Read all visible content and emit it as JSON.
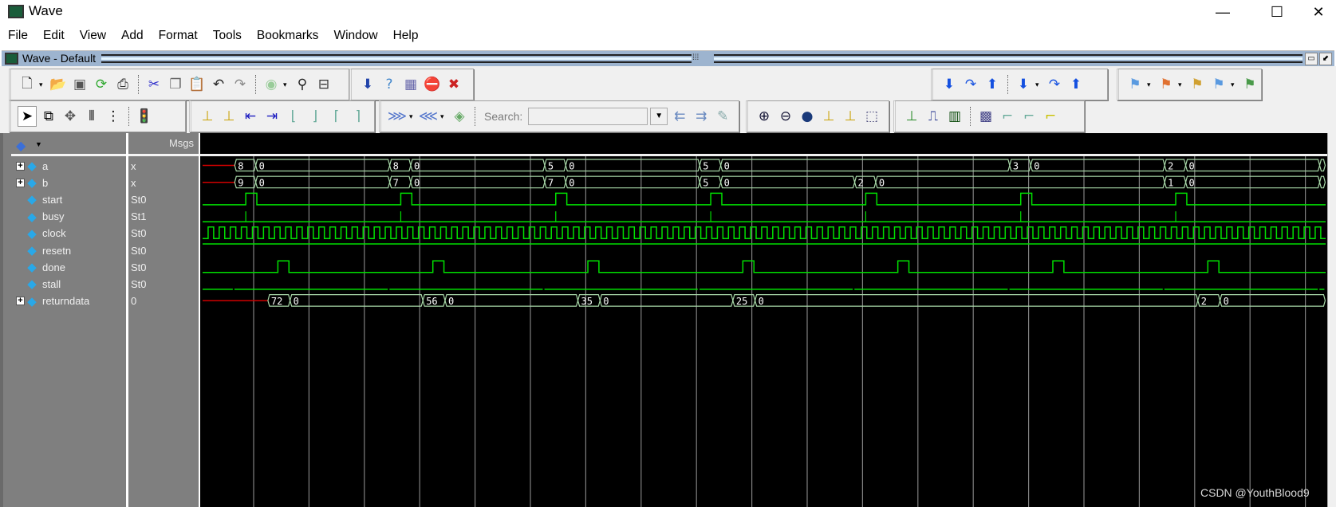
{
  "window": {
    "title": "Wave",
    "minimize": "—",
    "maximize": "☐",
    "close": "✕"
  },
  "menu": [
    "File",
    "Edit",
    "View",
    "Add",
    "Format",
    "Tools",
    "Bookmarks",
    "Window",
    "Help"
  ],
  "subwindow": {
    "title": "Wave - Default",
    "grip": "⁞⁞⁞",
    "btn1": "▭",
    "btn2": "⬋"
  },
  "toolbars": {
    "row1": [
      [
        "new-file-icon",
        "dropdown",
        "open-folder-icon",
        "save-icon",
        "reload-icon",
        "print-icon",
        "sep",
        "cut-icon",
        "copy-icon",
        "paste-icon",
        "undo-icon",
        "redo-icon",
        "sep",
        "run-icon",
        "dropdown",
        "find-icon",
        "collapse-all-icon"
      ],
      [
        "load-dataflow-icon",
        "query-icon",
        "memory-icon",
        "break-icon",
        "delete-icon"
      ],
      [
        "step-into-icon",
        "step-over-icon",
        "step-out-icon",
        "sep",
        "step-into-wave-icon",
        "dropdown",
        "step-over-wave-icon",
        "step-out-wave-icon"
      ],
      [
        "bookmark-add-icon",
        "dropdown",
        "bookmark-remove-icon",
        "dropdown",
        "bookmark-edit-icon",
        "bookmark-save-icon",
        "dropdown",
        "bookmark-goto-icon"
      ]
    ],
    "row2": [
      [
        "select-pointer-icon",
        "zoom-mode-icon",
        "pan-mode-icon",
        "cursor-mode-icon",
        "edit-mode-icon",
        "sep",
        "stop-light-icon"
      ],
      [
        "add-cursor-icon",
        "delete-cursor-icon",
        "prev-transition-icon",
        "next-transition-icon",
        "prev-falling-edge-icon",
        "next-falling-edge-icon",
        "prev-rising-edge-icon",
        "next-rising-edge-icon"
      ],
      [
        "expand-time-icon",
        "dropdown",
        "collapse-time-icon",
        "dropdown",
        "show-driver-icon",
        "sep",
        "search-label",
        "search-input",
        "search-dropdown",
        "search-prev-icon",
        "search-next-icon",
        "search-options-icon"
      ],
      [
        "zoom-in-icon",
        "zoom-out-icon",
        "zoom-full-icon",
        "zoom-cursor-icon",
        "zoom-between-cursors-icon",
        "zoom-region-icon"
      ],
      [
        "wave-edge-style-icon",
        "wave-pulse-style-icon",
        "wave-multi-style-icon",
        "sep",
        "grid-icon",
        "edge-style-1-icon",
        "edge-style-2-icon",
        "edge-style-3-icon"
      ]
    ]
  },
  "search": {
    "label": "Search:",
    "value": "",
    "placeholder": ""
  },
  "pane": {
    "msgs_header": "Msgs",
    "header_icon": "wave-add-icon"
  },
  "colors": {
    "waveform": "#00e000",
    "bus": "#a8d8a8",
    "undefined": "#d00000",
    "grid": "#808080",
    "background": "#000000"
  },
  "waveform": {
    "time_end": 1014,
    "clock_period": 10,
    "clock_first_rise": 5,
    "signals": [
      {
        "name": "a",
        "value": "x",
        "type": "bus",
        "expandable": true,
        "segments": [
          [
            0,
            29,
            "x"
          ],
          [
            29,
            48,
            "8"
          ],
          [
            48,
            169,
            "0"
          ],
          [
            169,
            188,
            "8"
          ],
          [
            188,
            309,
            "0"
          ],
          [
            309,
            328,
            "5"
          ],
          [
            328,
            449,
            "0"
          ],
          [
            449,
            468,
            "5"
          ],
          [
            468,
            729,
            "0"
          ],
          [
            729,
            748,
            "3"
          ],
          [
            748,
            869,
            "0"
          ],
          [
            869,
            888,
            "2"
          ],
          [
            888,
            1009,
            "0"
          ],
          [
            1009,
            1014,
            ""
          ]
        ]
      },
      {
        "name": "b",
        "value": "x",
        "type": "bus",
        "expandable": true,
        "segments": [
          [
            0,
            29,
            "x"
          ],
          [
            29,
            48,
            "9"
          ],
          [
            48,
            169,
            "0"
          ],
          [
            169,
            188,
            "7"
          ],
          [
            188,
            309,
            "0"
          ],
          [
            309,
            328,
            "7"
          ],
          [
            328,
            449,
            "0"
          ],
          [
            449,
            468,
            "5"
          ],
          [
            468,
            589,
            "0"
          ],
          [
            589,
            608,
            "2"
          ],
          [
            608,
            869,
            "0"
          ],
          [
            869,
            888,
            "1"
          ],
          [
            888,
            1009,
            "0"
          ],
          [
            1009,
            1014,
            ""
          ]
        ]
      },
      {
        "name": "start",
        "value": "St0",
        "type": "pulses",
        "pulses": [
          [
            39,
            49
          ],
          [
            179,
            189
          ],
          [
            319,
            329
          ],
          [
            459,
            469
          ],
          [
            599,
            609
          ],
          [
            739,
            749
          ],
          [
            879,
            889
          ]
        ]
      },
      {
        "name": "busy",
        "value": "St1",
        "type": "ticks",
        "ticks": [
          39,
          179,
          319,
          459,
          599,
          739,
          879
        ]
      },
      {
        "name": "clock",
        "value": "St0",
        "type": "clock"
      },
      {
        "name": "resetn",
        "value": "St0",
        "type": "const",
        "level": 1
      },
      {
        "name": "done",
        "value": "St0",
        "type": "pulses",
        "pulses": [
          [
            68,
            78
          ],
          [
            208,
            218
          ],
          [
            348,
            358
          ],
          [
            488,
            498
          ],
          [
            628,
            638
          ],
          [
            768,
            778
          ],
          [
            908,
            918
          ]
        ]
      },
      {
        "name": "stall",
        "value": "St0",
        "type": "glitch",
        "glitches": [
          28,
          168,
          308,
          448,
          588,
          728,
          868,
          1008
        ]
      },
      {
        "name": "returndata",
        "value": "0",
        "type": "bus",
        "expandable": true,
        "segments": [
          [
            0,
            59,
            "x"
          ],
          [
            59,
            79,
            "72"
          ],
          [
            79,
            199,
            "0"
          ],
          [
            199,
            219,
            "56"
          ],
          [
            219,
            339,
            "0"
          ],
          [
            339,
            359,
            "35"
          ],
          [
            359,
            479,
            "0"
          ],
          [
            479,
            499,
            "25"
          ],
          [
            499,
            899,
            "0"
          ],
          [
            899,
            919,
            "2"
          ],
          [
            919,
            1014,
            "0"
          ]
        ]
      }
    ]
  },
  "watermark": "CSDN @YouthBlood9"
}
